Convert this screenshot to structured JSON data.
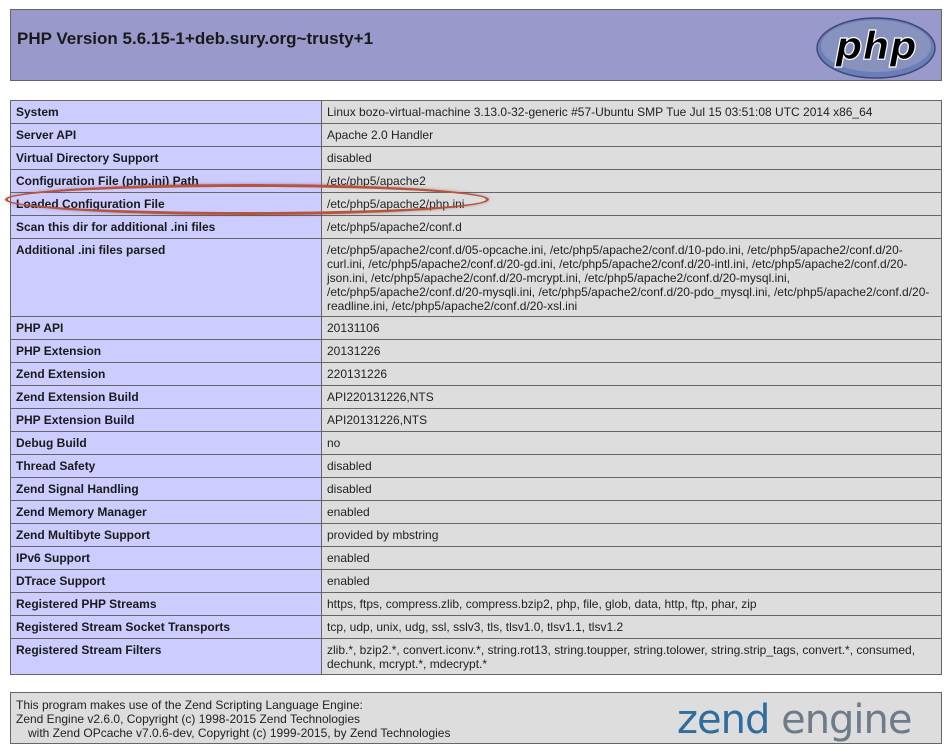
{
  "header": {
    "title": "PHP Version 5.6.15-1+deb.sury.org~trusty+1",
    "logo_text": "php"
  },
  "colors": {
    "header_bg": "#9999cc",
    "label_bg": "#ccccff",
    "value_bg": "#dddddd",
    "highlight": "#b5543f",
    "zend_blue": "#2f6d9e"
  },
  "rows": [
    {
      "label": "System",
      "value": "Linux bozo-virtual-machine 3.13.0-32-generic #57-Ubuntu SMP Tue Jul 15 03:51:08 UTC 2014 x86_64"
    },
    {
      "label": "Server API",
      "value": "Apache 2.0 Handler"
    },
    {
      "label": "Virtual Directory Support",
      "value": "disabled"
    },
    {
      "label": "Configuration File (php.ini) Path",
      "value": "/etc/php5/apache2"
    },
    {
      "label": "Loaded Configuration File",
      "value": "/etc/php5/apache2/php.ini"
    },
    {
      "label": "Scan this dir for additional .ini files",
      "value": "/etc/php5/apache2/conf.d"
    },
    {
      "label": "Additional .ini files parsed",
      "value": "/etc/php5/apache2/conf.d/05-opcache.ini, /etc/php5/apache2/conf.d/10-pdo.ini, /etc/php5/apache2/conf.d/20-curl.ini, /etc/php5/apache2/conf.d/20-gd.ini, /etc/php5/apache2/conf.d/20-intl.ini, /etc/php5/apache2/conf.d/20-json.ini, /etc/php5/apache2/conf.d/20-mcrypt.ini, /etc/php5/apache2/conf.d/20-mysql.ini, /etc/php5/apache2/conf.d/20-mysqli.ini, /etc/php5/apache2/conf.d/20-pdo_mysql.ini, /etc/php5/apache2/conf.d/20-readline.ini, /etc/php5/apache2/conf.d/20-xsl.ini"
    },
    {
      "label": "PHP API",
      "value": "20131106"
    },
    {
      "label": "PHP Extension",
      "value": "20131226"
    },
    {
      "label": "Zend Extension",
      "value": "220131226"
    },
    {
      "label": "Zend Extension Build",
      "value": "API220131226,NTS"
    },
    {
      "label": "PHP Extension Build",
      "value": "API20131226,NTS"
    },
    {
      "label": "Debug Build",
      "value": "no"
    },
    {
      "label": "Thread Safety",
      "value": "disabled"
    },
    {
      "label": "Zend Signal Handling",
      "value": "disabled"
    },
    {
      "label": "Zend Memory Manager",
      "value": "enabled"
    },
    {
      "label": "Zend Multibyte Support",
      "value": "provided by mbstring"
    },
    {
      "label": "IPv6 Support",
      "value": "enabled"
    },
    {
      "label": "DTrace Support",
      "value": "enabled"
    },
    {
      "label": "Registered PHP Streams",
      "value": "https, ftps, compress.zlib, compress.bzip2, php, file, glob, data, http, ftp, phar, zip"
    },
    {
      "label": "Registered Stream Socket Transports",
      "value": "tcp, udp, unix, udg, ssl, sslv3, tls, tlsv1.0, tlsv1.1, tlsv1.2"
    },
    {
      "label": "Registered Stream Filters",
      "value": "zlib.*, bzip2.*, convert.iconv.*, string.rot13, string.toupper, string.tolower, string.strip_tags, convert.*, consumed, dechunk, mcrypt.*, mdecrypt.*"
    }
  ],
  "footer": {
    "line1": "This program makes use of the Zend Scripting Language Engine:",
    "line2": "Zend Engine v2.6.0, Copyright (c) 1998-2015 Zend Technologies",
    "line3": "with Zend OPcache v7.0.6-dev, Copyright (c) 1999-2015, by Zend Technologies",
    "logo_left": "zend",
    "logo_right": "engine"
  }
}
